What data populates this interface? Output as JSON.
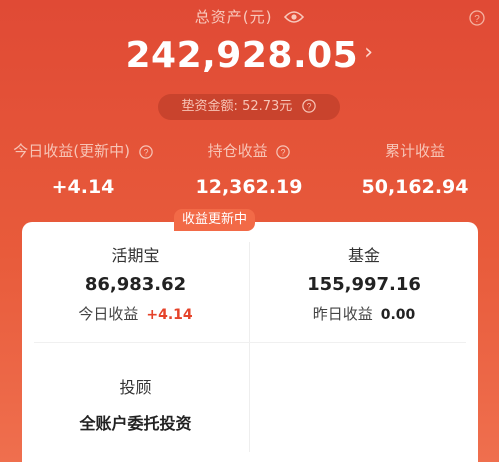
{
  "header": {
    "total_label": "总资产(元)",
    "total_value": "242,928.05",
    "advance_label": "垫资金额:",
    "advance_value": "52.73元"
  },
  "metrics": [
    {
      "label": "今日收益(更新中)",
      "value": "+4.14"
    },
    {
      "label": "持仓收益",
      "value": "12,362.19"
    },
    {
      "label": "累计收益",
      "value": "50,162.94"
    }
  ],
  "cards": {
    "huoqibao": {
      "title": "活期宝",
      "badge": "收益更新中",
      "amount": "86,983.62",
      "sub_label": "今日收益",
      "sub_value": "+4.14"
    },
    "fund": {
      "title": "基金",
      "amount": "155,997.16",
      "sub_label": "昨日收益",
      "sub_value": "0.00"
    },
    "advisor": {
      "title": "投顾",
      "subtitle": "全账户委托投资"
    }
  },
  "icons": [
    "eye-icon",
    "help-icon",
    "chevron-right-icon"
  ],
  "colors": {
    "primary": "#e85a3c",
    "badge": "#f26a47",
    "gain": "#e5432a"
  }
}
